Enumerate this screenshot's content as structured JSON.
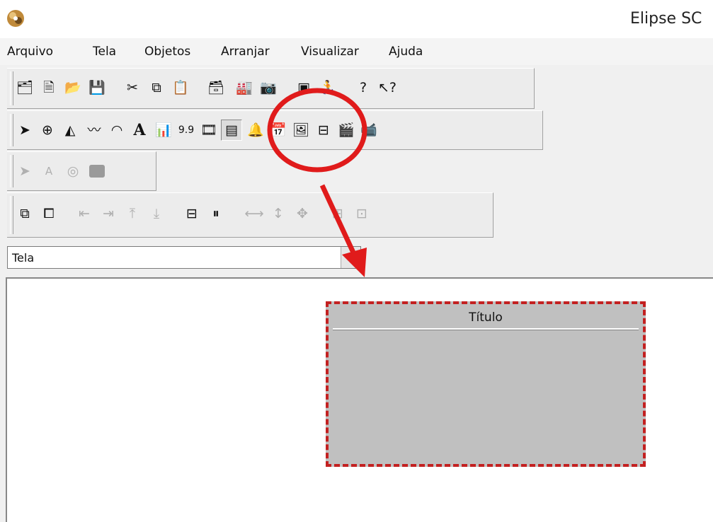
{
  "window": {
    "title": "Elipse SC"
  },
  "menu": {
    "items": [
      {
        "label": "Arquivo"
      },
      {
        "label": "Tela"
      },
      {
        "label": "Objetos"
      },
      {
        "label": "Arranjar"
      },
      {
        "label": "Visualizar"
      },
      {
        "label": "Ajuda"
      }
    ]
  },
  "toolbar_objects": {
    "text_tool": "A",
    "numeric_display": "9.9"
  },
  "toolbar_disabled": {
    "text_tool": "A"
  },
  "screen_selector": {
    "value": "Tela"
  },
  "canvas": {
    "panel_title": "Título"
  },
  "annotation": {
    "color": "#e01b1b"
  }
}
